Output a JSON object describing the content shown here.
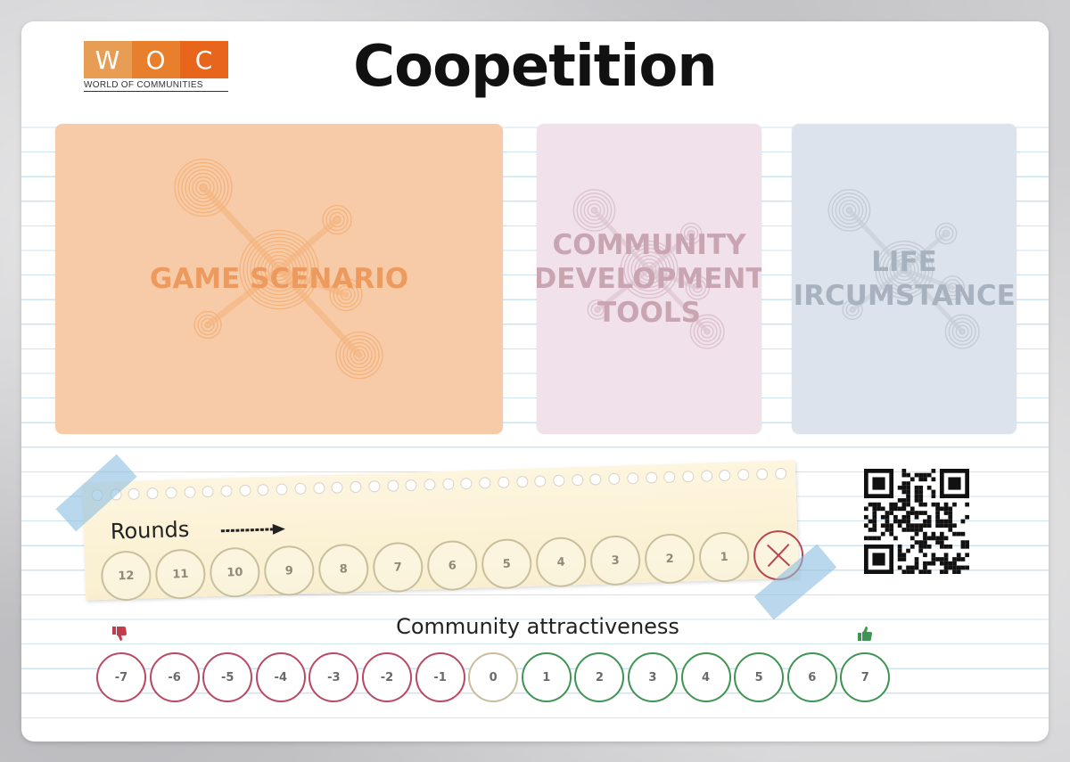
{
  "title": "Coopetition",
  "logo": {
    "letters": [
      "W",
      "O",
      "C"
    ],
    "letter_colors": [
      "#e89d55",
      "#e87f2c",
      "#e8661b"
    ],
    "subtitle": "WORLD OF COMMUNITIES"
  },
  "cards": [
    {
      "label": "GAME SCENARIO",
      "bg": "#f8cba8",
      "text_color": "#ec9a5d",
      "motif_color": "#f4b47e"
    },
    {
      "label": "COMMUNITY\nDEVELOPMENT\nTOOLS",
      "bg": "#f0e1ea",
      "text_color": "#c9a4b1",
      "motif_color": "#dcc3cd"
    },
    {
      "label": "LIFE\nCIRCUMSTANCES",
      "bg": "#dde3ec",
      "text_color": "#a8b2bf",
      "motif_color": "#c5ccd6"
    }
  ],
  "rounds": {
    "label": "Rounds",
    "values": [
      "12",
      "11",
      "10",
      "9",
      "8",
      "7",
      "6",
      "5",
      "4",
      "3",
      "2",
      "1"
    ],
    "end_marker_icon": "x-circle-icon",
    "end_color": "#b8474f"
  },
  "attractiveness": {
    "label": "Community attractiveness",
    "values": [
      "-7",
      "-6",
      "-5",
      "-4",
      "-3",
      "-2",
      "-1",
      "0",
      "1",
      "2",
      "3",
      "4",
      "5",
      "6",
      "7"
    ],
    "negative_color": "#b84a64",
    "neutral_color": "#c9bf9c",
    "positive_color": "#3f9553",
    "left_icon": "thumbs-down-icon",
    "right_icon": "thumbs-up-icon"
  },
  "qr_icon": "qr-code-icon"
}
